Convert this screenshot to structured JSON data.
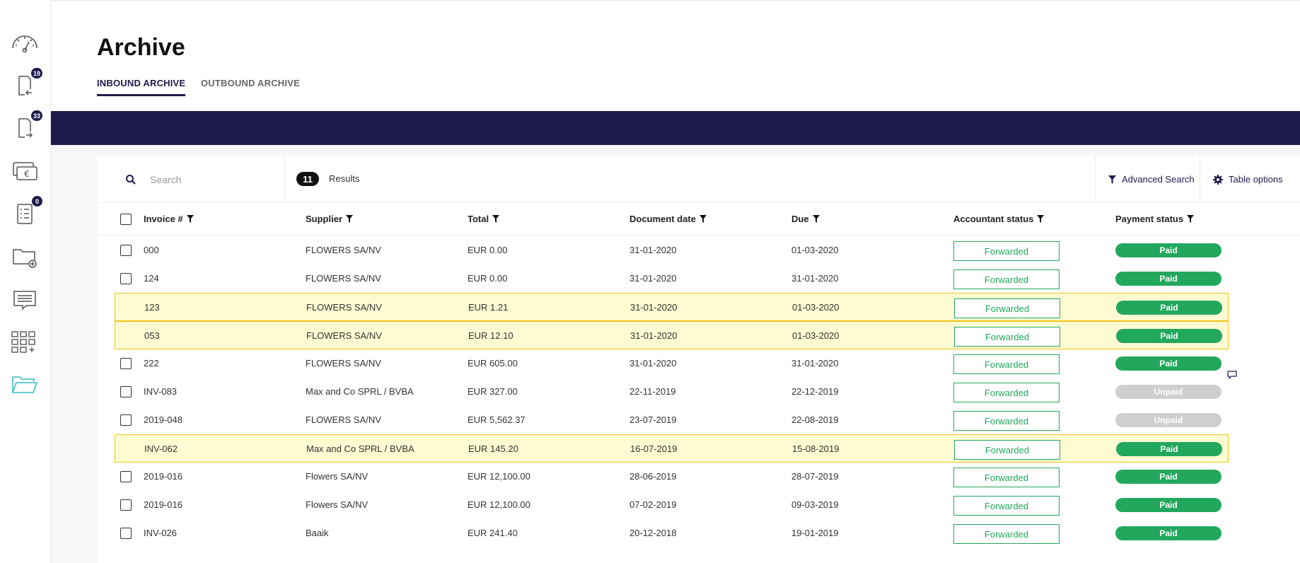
{
  "sidebar": {
    "items": [
      {
        "icon": "dashboard-gauge-icon",
        "badge": ""
      },
      {
        "icon": "inbound-documents-icon",
        "badge": "19"
      },
      {
        "icon": "outbound-documents-icon",
        "badge": "33"
      },
      {
        "icon": "payments-euro-icon",
        "badge": ""
      },
      {
        "icon": "checklist-icon",
        "badge": "0"
      },
      {
        "icon": "folder-add-icon",
        "badge": ""
      },
      {
        "icon": "messages-icon",
        "badge": ""
      },
      {
        "icon": "apps-grid-icon",
        "badge": ""
      },
      {
        "icon": "archive-folder-icon",
        "badge": ""
      }
    ]
  },
  "header": {
    "title": "Archive",
    "tabs": [
      {
        "label": "INBOUND ARCHIVE",
        "active": true
      },
      {
        "label": "OUTBOUND ARCHIVE",
        "active": false
      }
    ]
  },
  "toolbar": {
    "search_placeholder": "Search",
    "results_count": "11",
    "results_label": "Results",
    "advanced_search": "Advanced Search",
    "table_options": "Table options"
  },
  "table": {
    "columns": [
      "Invoice #",
      "Supplier",
      "Total",
      "Document date",
      "Due",
      "Accountant status",
      "Payment status"
    ],
    "rows": [
      {
        "invoice": "000",
        "supplier": "FLOWERS SA/NV",
        "total": "EUR 0.00",
        "doc_date": "31-01-2020",
        "due": "01-03-2020",
        "acc_status": "Forwarded",
        "pay_status": "Paid",
        "highlight": false
      },
      {
        "invoice": "124",
        "supplier": "FLOWERS SA/NV",
        "total": "EUR 0.00",
        "doc_date": "31-01-2020",
        "due": "31-01-2020",
        "acc_status": "Forwarded",
        "pay_status": "Paid",
        "highlight": false
      },
      {
        "invoice": "123",
        "supplier": "FLOWERS SA/NV",
        "total": "EUR 1.21",
        "doc_date": "31-01-2020",
        "due": "01-03-2020",
        "acc_status": "Forwarded",
        "pay_status": "Paid",
        "highlight": true
      },
      {
        "invoice": "053",
        "supplier": "FLOWERS SA/NV",
        "total": "EUR 12.10",
        "doc_date": "31-01-2020",
        "due": "01-03-2020",
        "acc_status": "Forwarded",
        "pay_status": "Paid",
        "highlight": true
      },
      {
        "invoice": "222",
        "supplier": "FLOWERS SA/NV",
        "total": "EUR 605.00",
        "doc_date": "31-01-2020",
        "due": "31-01-2020",
        "acc_status": "Forwarded",
        "pay_status": "Paid",
        "highlight": false
      },
      {
        "invoice": "INV-083",
        "supplier": "Max and Co SPRL / BVBA",
        "total": "EUR 327.00",
        "doc_date": "22-11-2019",
        "due": "22-12-2019",
        "acc_status": "Forwarded",
        "pay_status": "Unpaid",
        "highlight": false
      },
      {
        "invoice": "2019-048",
        "supplier": "FLOWERS SA/NV",
        "total": "EUR 5,562.37",
        "doc_date": "23-07-2019",
        "due": "22-08-2019",
        "acc_status": "Forwarded",
        "pay_status": "Unpaid",
        "highlight": false
      },
      {
        "invoice": "INV-062",
        "supplier": "Max and Co SPRL / BVBA",
        "total": "EUR 145.20",
        "doc_date": "16-07-2019",
        "due": "15-08-2019",
        "acc_status": "Forwarded",
        "pay_status": "Paid",
        "highlight": true
      },
      {
        "invoice": "2019-016",
        "supplier": "Flowers SA/NV",
        "total": "EUR 12,100.00",
        "doc_date": "28-06-2019",
        "due": "28-07-2019",
        "acc_status": "Forwarded",
        "pay_status": "Paid",
        "highlight": false
      },
      {
        "invoice": "2019-016",
        "supplier": "Flowers SA/NV",
        "total": "EUR 12,100.00",
        "doc_date": "07-02-2019",
        "due": "09-03-2019",
        "acc_status": "Forwarded",
        "pay_status": "Paid",
        "highlight": false
      },
      {
        "invoice": "INV-026",
        "supplier": "Baaik",
        "total": "EUR 241.40",
        "doc_date": "20-12-2018",
        "due": "19-01-2019",
        "acc_status": "Forwarded",
        "pay_status": "Paid",
        "highlight": false
      }
    ]
  },
  "colors": {
    "navy": "#1f1c4b",
    "green": "#22a85d",
    "unpaid_grey": "#cfcfcf",
    "highlight_fill": "#fefbd2",
    "highlight_border": "#f5c518",
    "teal_icon": "#4cc4c8"
  }
}
